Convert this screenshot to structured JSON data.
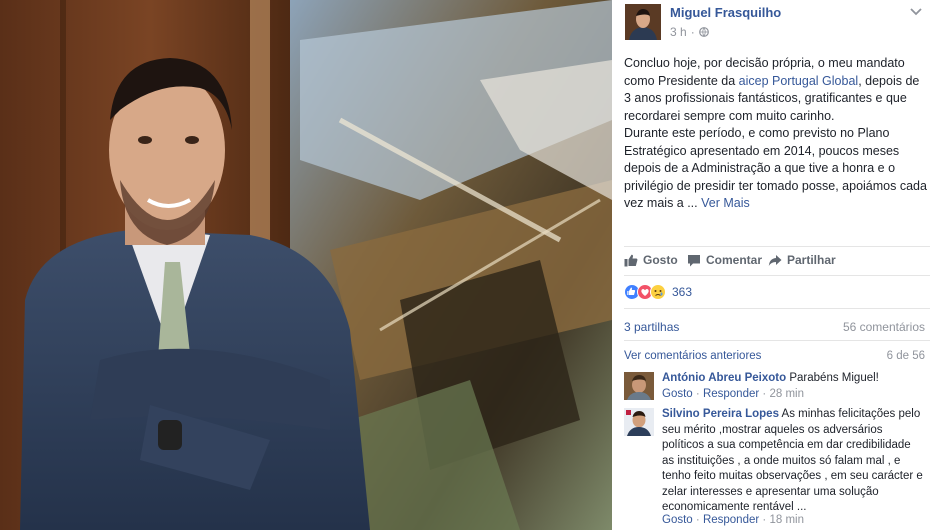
{
  "post": {
    "author": "Miguel Frasquilho",
    "time": "3 h",
    "dot": "·",
    "text_1": "Concluo hoje, por decisão própria, o meu mandato como Presidente da ",
    "text_link": "aicep Portugal Global",
    "text_2": ", depois de 3 anos profissionais fantásticos, gratificantes e que recordarei sempre com muito carinho.",
    "text_3": "Durante este período, e como previsto no Plano Estratégico apresentado em 2014, poucos meses depois de a Administração a que tive a honra e o privilégio de presidir ter tomado posse, apoiámos cada vez mais a ... ",
    "see_more": "Ver Mais"
  },
  "actions": {
    "like": "Gosto",
    "comment": "Comentar",
    "share": "Partilhar"
  },
  "reactions": {
    "count": "363"
  },
  "stats": {
    "shares": "3 partilhas",
    "comments": "56 comentários"
  },
  "comments_header": {
    "previous": "Ver comentários anteriores",
    "pager": "6 de 56"
  },
  "comments": [
    {
      "name": "António Abreu Peixoto",
      "text": "Parabéns Miguel!",
      "like": "Gosto",
      "sep": "·",
      "reply": "Responder",
      "time": "28 min"
    },
    {
      "name": "Silvino Pereira Lopes",
      "text": "As minhas felicitações pelo seu mérito ,mostrar aqueles os adversários políticos a sua competência em dar credibilidade as instituições , a onde muitos só falam mal , e tenho feito muitas observações , em seu carácter e zelar interesses e apresentar uma solução economicamente rentável ...",
      "like": "Gosto",
      "sep": "·",
      "reply": "Responder",
      "time": "18 min"
    }
  ],
  "colors": {
    "link": "#365899",
    "muted": "#90949c",
    "like_blue": "#4080ff",
    "love_red": "#f25268",
    "sad_yellow": "#fcd040"
  }
}
